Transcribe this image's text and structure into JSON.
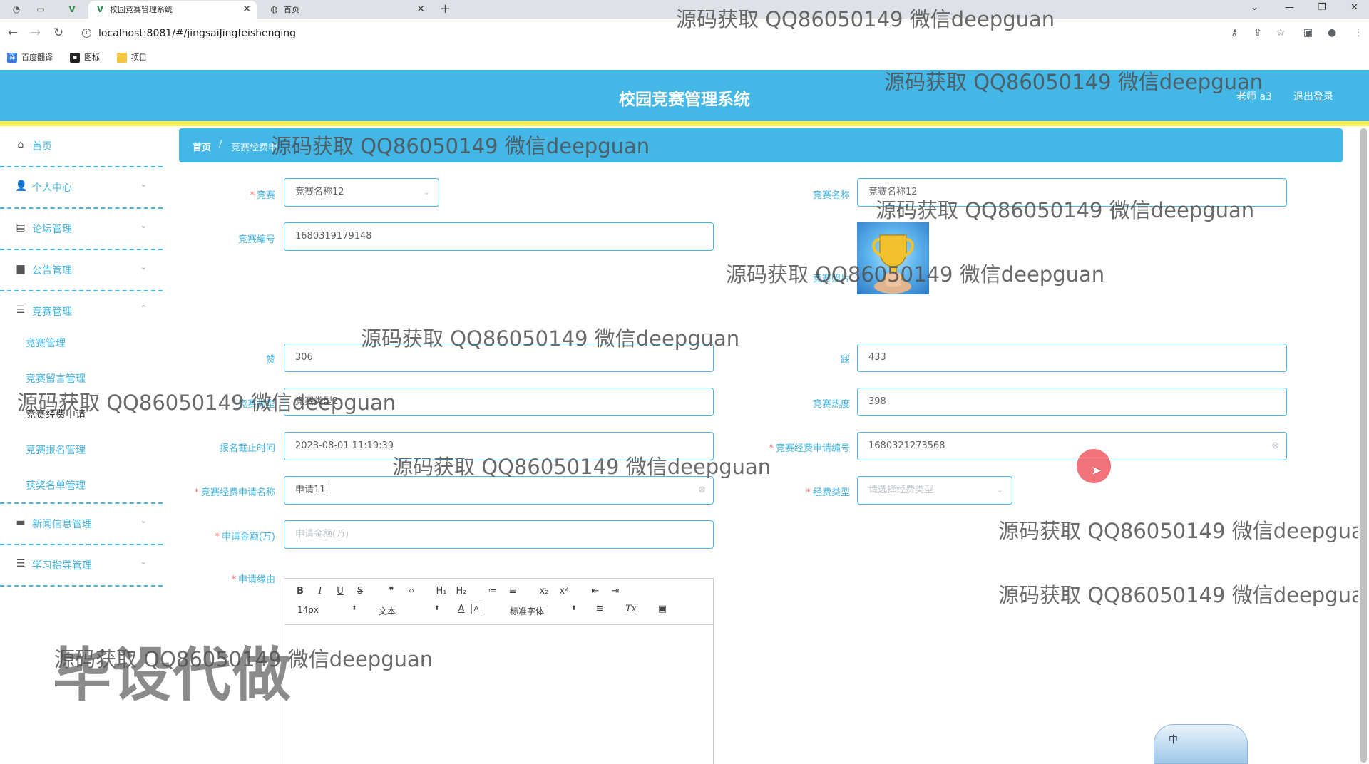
{
  "browser": {
    "tabs": [
      {
        "title": "校园竞赛管理系统",
        "close": "✕",
        "active": true
      },
      {
        "title": "首页",
        "close": "✕",
        "active": false
      }
    ],
    "new_tab": "+",
    "url": "localhost:8081/#/jingsaiJingfeishenqing",
    "nav": {
      "back": "←",
      "forward": "→",
      "reload": "↻"
    },
    "window_controls": {
      "dropdown": "⌄",
      "minimize": "—",
      "restore": "❐",
      "close": "✕"
    },
    "bookmarks": [
      "百度翻译",
      "图标",
      "项目"
    ],
    "right_icons": {
      "key": "⚷",
      "share": "⇪",
      "star": "☆",
      "sidebar": "▣",
      "profile": "●",
      "menu": "⋮"
    }
  },
  "header": {
    "title": "校园竞赛管理系统",
    "user": "老师 a3",
    "logout": "退出登录"
  },
  "sidebar": {
    "items": [
      {
        "label": "首页",
        "icon": "home-icon",
        "glyph": "⌂",
        "arrow": ""
      },
      {
        "label": "个人中心",
        "icon": "user-icon",
        "glyph": "👤",
        "arrow": "⌄"
      },
      {
        "label": "论坛管理",
        "icon": "forum-icon",
        "glyph": "▤",
        "arrow": "⌄"
      },
      {
        "label": "公告管理",
        "icon": "notice-icon",
        "glyph": "▆",
        "arrow": "⌄"
      },
      {
        "label": "竞赛管理",
        "icon": "list-icon",
        "glyph": "☰",
        "arrow": "⌃"
      },
      {
        "label": "新闻信息管理",
        "icon": "news-icon",
        "glyph": "▬",
        "arrow": "⌄"
      },
      {
        "label": "学习指导管理",
        "icon": "guide-icon",
        "glyph": "☰",
        "arrow": "⌄"
      }
    ],
    "sub_items": [
      "竞赛管理",
      "竞赛留言管理",
      "竞赛经费申请",
      "竞赛报名管理",
      "获奖名单管理"
    ]
  },
  "breadcrumb": {
    "home": "首页",
    "sep": "/",
    "current": "竞赛经费申"
  },
  "form": {
    "jingsai_label": "竞赛",
    "jingsai_value": "竞赛名称12",
    "jingsai_name_label": "竞赛名称",
    "jingsai_name_value": "竞赛名称12",
    "jingsai_no_label": "竞赛编号",
    "jingsai_no_value": "1680319179148",
    "photo_label": "竞赛照片",
    "zan_label": "赞",
    "zan_value": "306",
    "cai_label": "踩",
    "cai_value": "433",
    "type_label": "竞赛类型",
    "type_value": "竞赛类型2",
    "heat_label": "竞赛热度",
    "heat_value": "398",
    "deadline_label": "报名截止时间",
    "deadline_value": "2023-08-01 11:19:39",
    "apply_no_label": "竞赛经费申请编号",
    "apply_no_value": "1680321273568",
    "apply_name_label": "竞赛经费申请名称",
    "apply_name_value": "申请11",
    "fee_type_label": "经费类型",
    "fee_type_placeholder": "请选择经费类型",
    "amount_label": "申请金额(万)",
    "amount_placeholder": "申请金额(万)",
    "reason_label": "申请缘由"
  },
  "editor": {
    "buttons": [
      "B",
      "I",
      "U",
      "S",
      "❞",
      "‹›",
      "H₁",
      "H₂",
      "≔",
      "≡",
      "x₂",
      "x²",
      "⇤",
      "⇥"
    ],
    "font_size": "14px",
    "text_style": "文本",
    "font_family": "标准字体",
    "align": "≡",
    "clear": "Tx",
    "image": "▣",
    "updown": "⬍",
    "color_glyph": "A",
    "bg_glyph": "A"
  },
  "watermarks": {
    "text": "源码获取 QQ86050149 微信deepguan",
    "big": "毕设代做"
  },
  "ime": "中"
}
